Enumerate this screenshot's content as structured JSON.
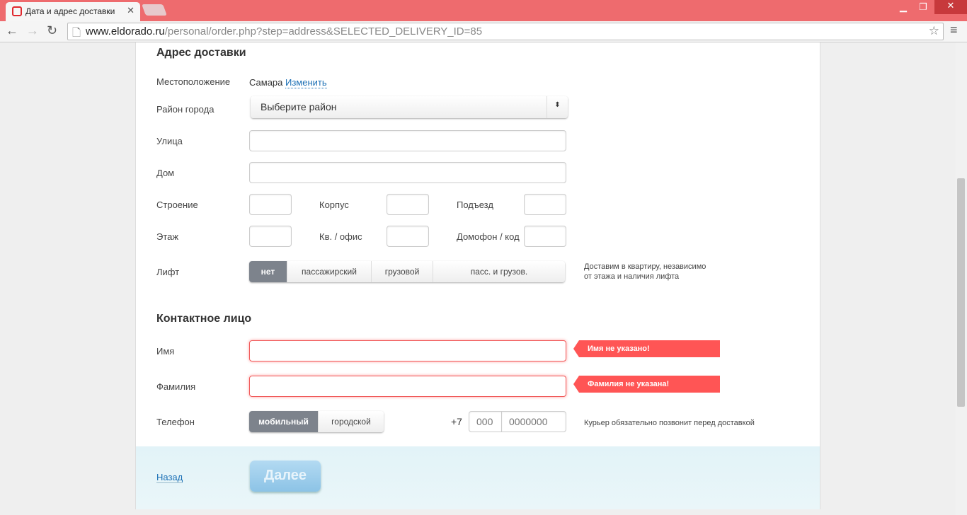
{
  "browser": {
    "tab_title": "Дата и адрес доставки",
    "url_domain": "www.eldorado.ru",
    "url_path": "/personal/order.php?step=address&SELECTED_DELIVERY_ID=85"
  },
  "address": {
    "heading": "Адрес доставки",
    "location_label": "Местоположение",
    "location_value": "Самара",
    "change_link": "Изменить",
    "district_label": "Район города",
    "district_value": "Выберите район",
    "street_label": "Улица",
    "house_label": "Дом",
    "building_label": "Строение",
    "korpus_label": "Корпус",
    "entrance_label": "Подъезд",
    "floor_label": "Этаж",
    "apt_label": "Кв. / офис",
    "intercom_label": "Домофон / код",
    "lift_label": "Лифт",
    "lift_options": [
      "нет",
      "пассажирский",
      "грузовой",
      "пасс. и грузов."
    ],
    "lift_note_1": "Доставим в квартиру, независимо",
    "lift_note_2": "от этажа и наличия лифта"
  },
  "contact": {
    "heading": "Контактное лицо",
    "name_label": "Имя",
    "name_error": "Имя не указано!",
    "surname_label": "Фамилия",
    "surname_error": "Фамилия не указана!",
    "phone_label": "Телефон",
    "phone_types": [
      "мобильный",
      "городской"
    ],
    "phone_prefix": "+7",
    "code_placeholder": "000",
    "number_placeholder": "0000000",
    "phone_note": "Курьер обязательно позвонит перед доставкой"
  },
  "footer": {
    "back": "Назад",
    "next": "Далее"
  }
}
